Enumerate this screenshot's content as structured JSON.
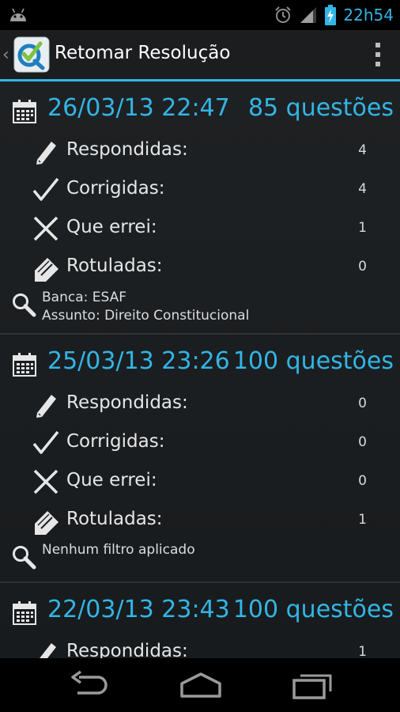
{
  "status_bar": {
    "time": "22h54",
    "icons": [
      "android-debug-icon",
      "alarm-icon",
      "signal-icon",
      "battery-charging-icon"
    ]
  },
  "action_bar": {
    "title": "Retomar Resolução",
    "up_glyph": "‹",
    "icons": [
      "app-logo-icon",
      "overflow-menu-icon"
    ]
  },
  "colors": {
    "accent": "#33b5e5",
    "background": "#1c1f21",
    "text": "#e6e6e6"
  },
  "sessions": [
    {
      "date": "26/03/13 22:47",
      "questions": "85 questões",
      "stats": [
        {
          "icon": "pencil-icon",
          "label": "Respondidas:",
          "value": "4"
        },
        {
          "icon": "check-icon",
          "label": "Corrigidas:",
          "value": "4"
        },
        {
          "icon": "x-icon",
          "label": "Que errei:",
          "value": "1"
        },
        {
          "icon": "tag-pencil-icon",
          "label": "Rotuladas:",
          "value": "0"
        }
      ],
      "filter_lines": [
        "Banca: ESAF",
        "Assunto: Direito Constitucional"
      ]
    },
    {
      "date": "25/03/13 23:26",
      "questions": "100 questões",
      "stats": [
        {
          "icon": "pencil-icon",
          "label": "Respondidas:",
          "value": "0"
        },
        {
          "icon": "check-icon",
          "label": "Corrigidas:",
          "value": "0"
        },
        {
          "icon": "x-icon",
          "label": "Que errei:",
          "value": "0"
        },
        {
          "icon": "tag-pencil-icon",
          "label": "Rotuladas:",
          "value": "1"
        }
      ],
      "filter_lines": [
        "Nenhum filtro aplicado"
      ]
    },
    {
      "date": "22/03/13 23:43",
      "questions": "100 questões",
      "stats": [
        {
          "icon": "pencil-icon",
          "label": "Respondidas:",
          "value": "1"
        }
      ]
    }
  ],
  "nav_bar": {
    "icons": [
      "back-icon",
      "home-icon",
      "recent-apps-icon"
    ]
  }
}
